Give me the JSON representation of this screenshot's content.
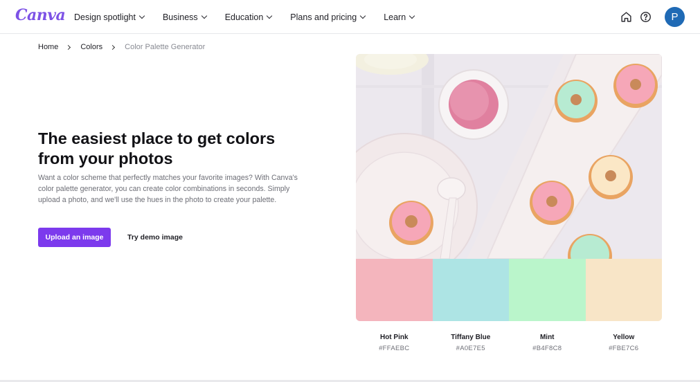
{
  "brand": {
    "logo_text": "Canva"
  },
  "nav": {
    "items": [
      {
        "label": "Design spotlight"
      },
      {
        "label": "Business"
      },
      {
        "label": "Education"
      },
      {
        "label": "Plans and pricing"
      },
      {
        "label": "Learn"
      }
    ],
    "icons": [
      "home-icon",
      "help-icon"
    ],
    "avatar_initial": "P"
  },
  "breadcrumb": [
    "Home",
    "Colors",
    "Color Palette Generator"
  ],
  "hero": {
    "title": "The easiest place to get colors from your photos",
    "description": "Want a color scheme that perfectly matches your favorite images? With Canva's color palette generator, you can create color combinations in seconds. Simply upload a photo, and we'll use the hues in the photo to create your palette.",
    "primary_button": "Upload an image",
    "secondary_button": "Try demo image"
  },
  "palette": [
    {
      "name": "Hot Pink",
      "hex": "#FFAEBC",
      "swatch": "#f4b5bd"
    },
    {
      "name": "Tiffany Blue",
      "hex": "#A0E7E5",
      "swatch": "#ade4e4"
    },
    {
      "name": "Mint",
      "hex": "#B4F8C8",
      "swatch": "#baf5cb"
    },
    {
      "name": "Yellow",
      "hex": "#FBE7C6",
      "swatch": "#f8e5c7"
    }
  ],
  "colors": {
    "accent": "#7c3aed",
    "avatar": "#1f6ab5"
  }
}
